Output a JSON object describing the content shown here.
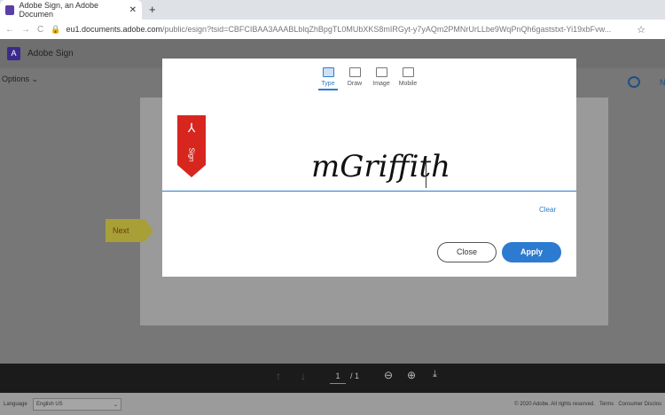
{
  "browser": {
    "tab_title": "Adobe Sign, an Adobe Documen",
    "url_host": "eu1.documents.adobe.com",
    "url_path": "/public/esign?tsid=CBFCIBAA3AAABLblqZhBpgTL0MUbXKS8mIRGyt-y7yAQm2PMNrUrLLbe9WqPnQh6gaststxt-Yi19xbFvw..."
  },
  "app": {
    "name": "Adobe Sign",
    "options": "Options ⌄",
    "next": "Next",
    "nav_m": "N"
  },
  "modal": {
    "modes": [
      "Type",
      "Draw",
      "Image",
      "Mobile"
    ],
    "flag_label": "Sign",
    "signature": "mGriffith",
    "clear": "Clear",
    "close": "Close",
    "apply": "Apply"
  },
  "toolbar": {
    "page": "1",
    "total": "/ 1"
  },
  "footer": {
    "language_label": "Language",
    "language": "English US",
    "copyright": "© 2020 Adobe. All rights reserved.",
    "terms": "Terms",
    "consumer": "Consumer Disclos"
  }
}
